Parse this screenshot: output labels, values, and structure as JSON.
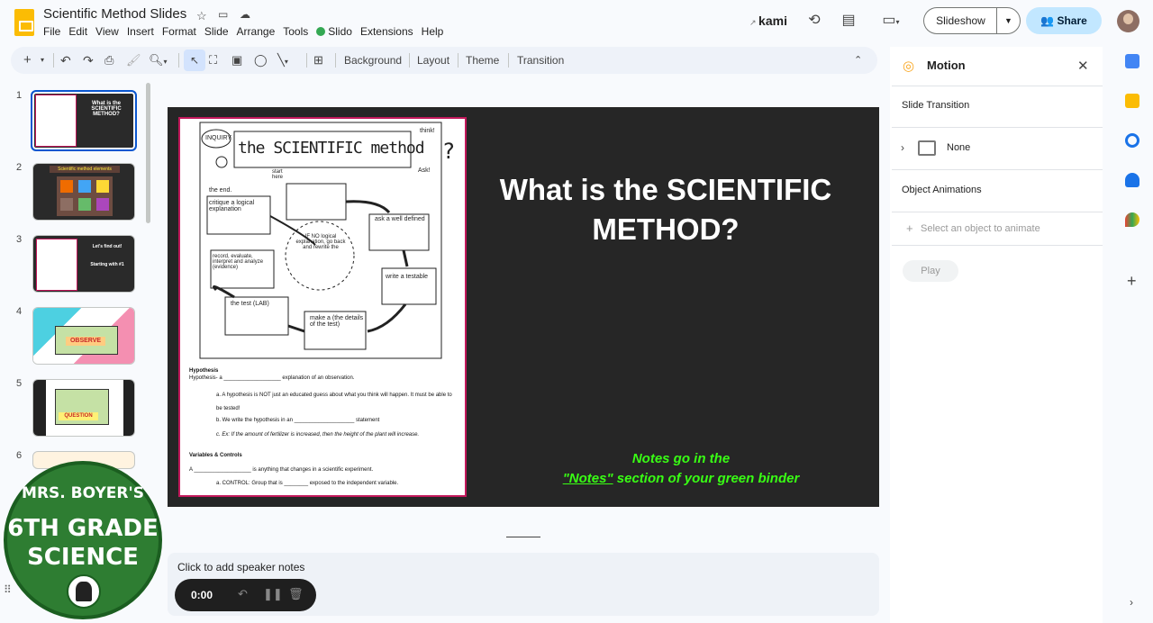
{
  "app": {
    "doc_title": "Scientific Method Slides"
  },
  "menu": [
    "File",
    "Edit",
    "View",
    "Insert",
    "Format",
    "Slide",
    "Arrange",
    "Tools",
    "Slido",
    "Extensions",
    "Help"
  ],
  "header": {
    "kami": "kami",
    "slideshow": "Slideshow",
    "share": "Share"
  },
  "toolbar": {
    "background": "Background",
    "layout": "Layout",
    "theme": "Theme",
    "transition": "Transition"
  },
  "filmstrip": {
    "numbers": [
      "1",
      "2",
      "3",
      "4",
      "5",
      "6"
    ],
    "thumb1_title": "What is the SCIENTIFIC METHOD?",
    "thumb2_title": "Scientific method elements",
    "thumb3_title": "Let's find out!",
    "thumb3_sub": "Starting with #1",
    "thumb4_label": "OBSERVE",
    "thumb5_label": "QUESTION"
  },
  "slide": {
    "title": "What is the SCIENTIFIC METHOD?",
    "note_line1": "Notes go in the",
    "note_link": "\"Notes\"",
    "note_line2": " section of your green binder",
    "doc": {
      "tag": "INQUIRY",
      "heading": "the SCIENTIFIC method",
      "think": "think!",
      "ask": "Ask!",
      "start": "start here",
      "end": "the end.",
      "steps": [
        "ask a well defined",
        "write a testable",
        "make a (the details of the test)",
        "the test (LAB)",
        "record, evaluate, interpret and analyze (evidence)",
        "critique a logical explanation"
      ],
      "center": "IF NO logical explanation, go back and rewrite the",
      "hyp_h": "Hypothesis",
      "hyp_1": "Hypothesis- a ___________________ explanation of an observation.",
      "hyp_a": "a.   A hypothesis is NOT just an educated guess about what you think will happen. It must be able to be tested!",
      "hyp_b": "b.   We write the hypothesis in an ____________________ statement",
      "hyp_c": "c.   Ex: If the amount of fertilizer is increased, then the height of the plant will increase.",
      "var_h": "Variables & Controls",
      "var_1": "A ___________________ is anything that changes in a scientific experiment.",
      "var_a": "a.   CONTROL: Group that is ________ exposed to the independent variable."
    }
  },
  "notes": {
    "placeholder": "Click to add speaker notes",
    "timer": "0:00"
  },
  "panel": {
    "title": "Motion",
    "slide_transition": "Slide Transition",
    "transition_value": "None",
    "object_animations": "Object Animations",
    "select_prompt": "Select an object to animate",
    "play": "Play"
  },
  "badge": {
    "line1": "MRS. BOYER'S",
    "line2": "6TH GRADE",
    "line3": "SCIENCE"
  },
  "colors": {
    "accent": "#0b57d0",
    "share_bg": "#c2e7ff",
    "slide_bg": "#262626",
    "note_green": "#39ff14",
    "doc_border": "#c2185b"
  }
}
